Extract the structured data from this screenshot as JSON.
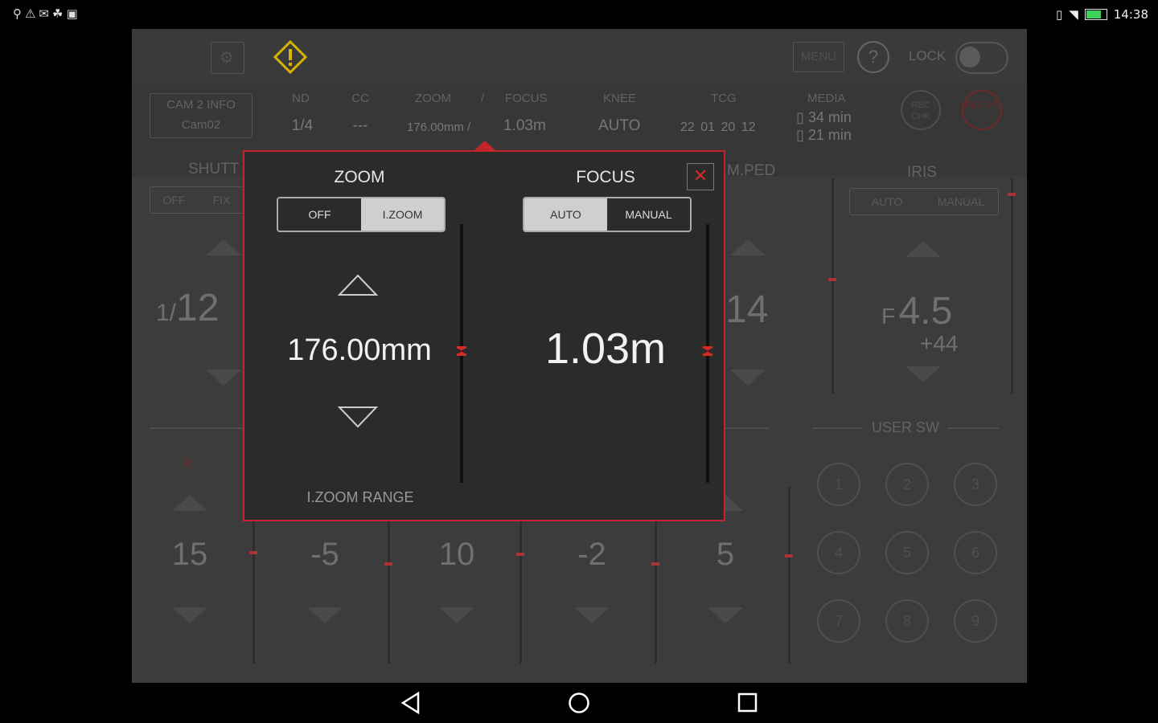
{
  "status_bar": {
    "left_icons": "⚲⚠✉☘▣",
    "time": "14:38"
  },
  "topbar": {
    "menu_label": "MENU",
    "help_label": "?",
    "lock_label": "LOCK"
  },
  "info": {
    "cam_info_label": "CAM 2 INFO",
    "cam_name": "Cam02",
    "nd_label": "ND",
    "nd_value": "1/4",
    "cc_label": "CC",
    "cc_value": "---",
    "zoom_label": "ZOOM",
    "slash": "/",
    "focus_label": "FOCUS",
    "zoom_value": "176.00mm /",
    "focus_value": "1.03m",
    "knee_label": "KNEE",
    "knee_value": "AUTO",
    "tcg_label": "TCG",
    "tcg_value": "22 01 20 12",
    "media_label": "MEDIA",
    "media_a": "34 min",
    "media_b": "21 min",
    "rec_chk": "REC CHK",
    "rec_ss": "REC S/S"
  },
  "background": {
    "shutter_label": "SHUTT",
    "shutter_off": "OFF",
    "shutter_fix": "FIX",
    "shutter_prefix": "1/",
    "shutter_value": "12",
    "mped_label": "M.PED",
    "mped_value": "14",
    "iris_label": "IRIS",
    "iris_auto": "AUTO",
    "iris_manual": "MANUAL",
    "iris_prefix": "F",
    "iris_value": "4.5",
    "iris_offset": "+44",
    "user_sw_label": "USER SW",
    "user_buttons": [
      "1",
      "2",
      "3",
      "4",
      "5",
      "6",
      "7",
      "8",
      "9"
    ],
    "r_label": "R",
    "gains": [
      "15",
      "-5",
      "10",
      "-2",
      "5"
    ]
  },
  "dialog": {
    "zoom_title": "ZOOM",
    "zoom_off": "OFF",
    "zoom_izoom": "I.ZOOM",
    "zoom_value": "176.00mm",
    "izoom_range": "I.ZOOM RANGE",
    "focus_title": "FOCUS",
    "focus_auto": "AUTO",
    "focus_manual": "MANUAL",
    "focus_value": "1.03m",
    "close_glyph": "✕"
  },
  "colors": {
    "accent": "#c4252a",
    "warning": "#d8b400"
  }
}
